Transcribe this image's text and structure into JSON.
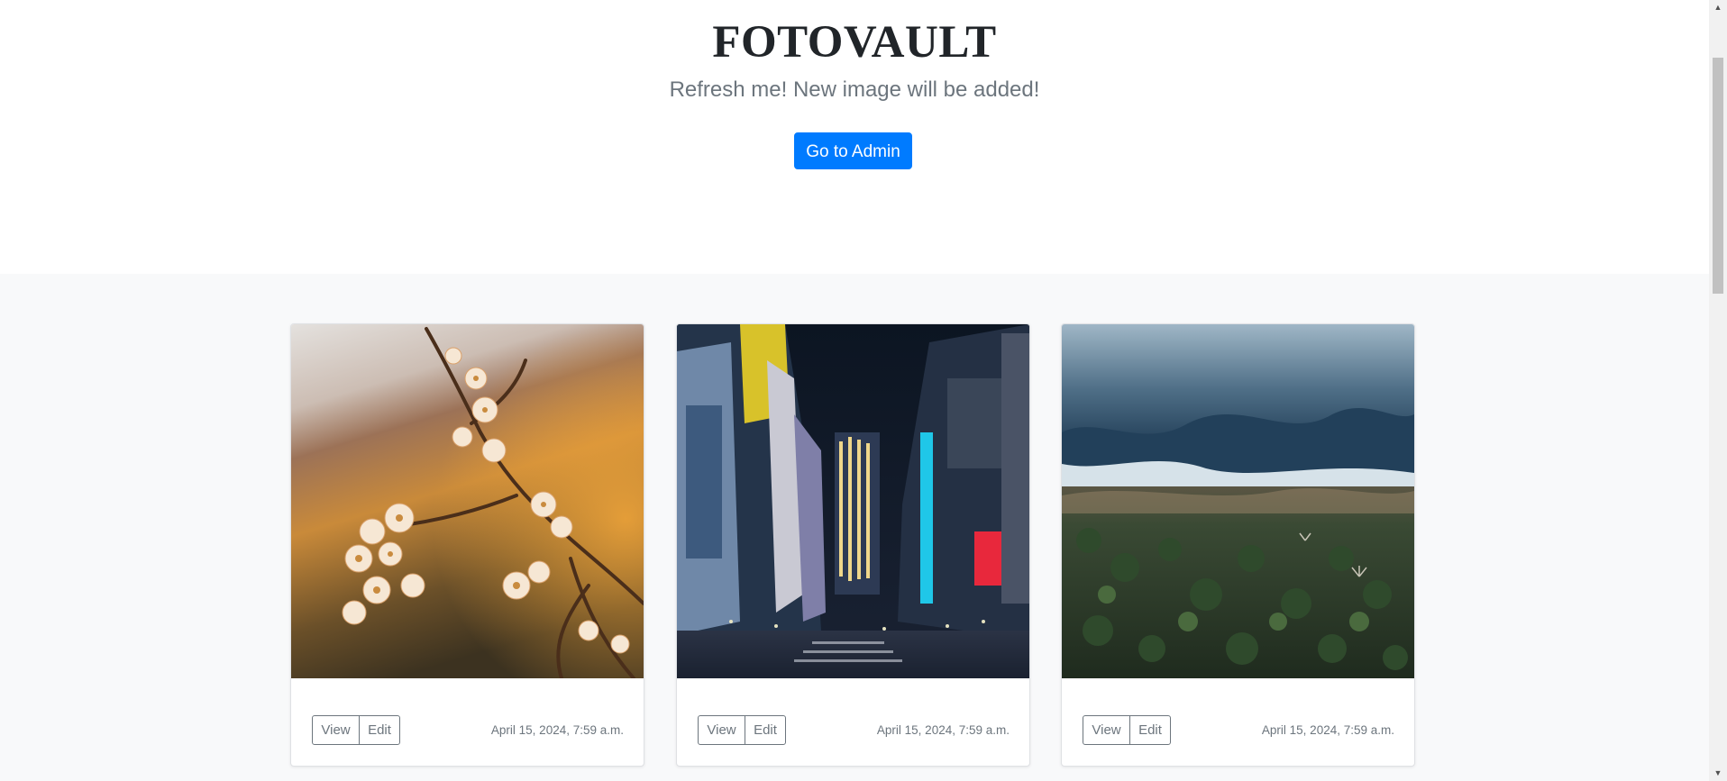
{
  "header": {
    "brand": "FOTOVAULT",
    "lead": "Refresh me! New image will be added!",
    "admin_button": "Go to Admin"
  },
  "cards": [
    {
      "image": "cherry-blossom-branch-photo",
      "view_label": "View",
      "edit_label": "Edit",
      "timestamp": "April 15, 2024, 7:59 a.m."
    },
    {
      "image": "city-street-night-photo",
      "view_label": "View",
      "edit_label": "Edit",
      "timestamp": "April 15, 2024, 7:59 a.m."
    },
    {
      "image": "aerial-frozen-lake-forest-photo",
      "view_label": "View",
      "edit_label": "Edit",
      "timestamp": "April 15, 2024, 7:59 a.m."
    }
  ],
  "colors": {
    "primary": "#007bff",
    "secondary": "#6c757d",
    "album_bg": "#f8f9fa"
  }
}
